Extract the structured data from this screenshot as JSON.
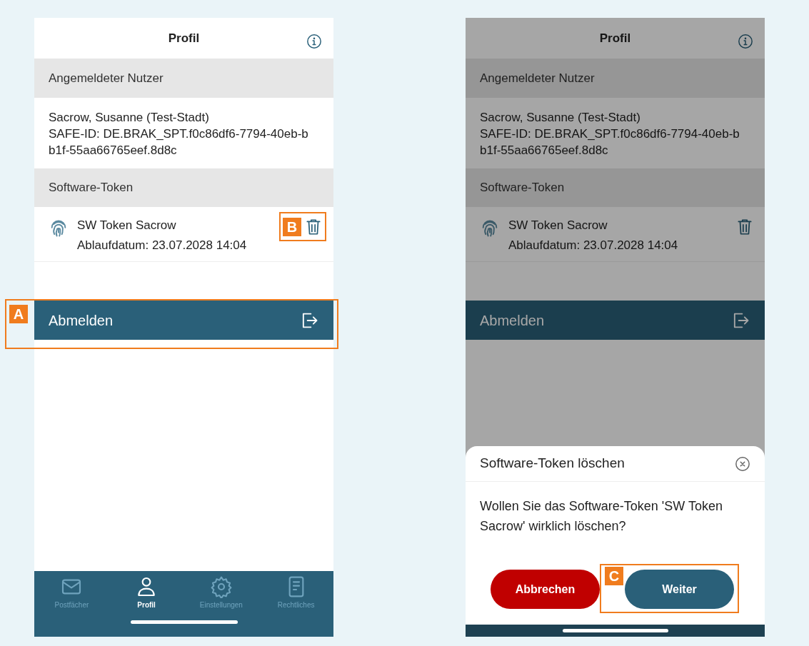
{
  "screens": [
    {
      "dimmed": false,
      "title": "Profil",
      "user_section": "Angemeldeter Nutzer",
      "user_name": "Sacrow, Susanne (Test-Stadt)",
      "safe_id": "SAFE-ID: DE.BRAK_SPT.f0c86df6-7794-40eb-b b1f-55aa66765eef.8d8c",
      "token_section": "Software-Token",
      "token": {
        "name": "SW Token Sacrow",
        "expiry": "Ablaufdatum: 23.07.2028 14:04",
        "callout": "B"
      },
      "logout": {
        "label": "Abmelden",
        "callout": "A"
      },
      "tab_bar": [
        {
          "label": "Postfächer",
          "selected": false
        },
        {
          "label": "Profil",
          "selected": true
        },
        {
          "label": "Einstellungen",
          "selected": false
        },
        {
          "label": "Rechtliches",
          "selected": false
        }
      ]
    },
    {
      "dimmed": true,
      "title": "Profil",
      "user_section": "Angemeldeter Nutzer",
      "user_name": "Sacrow, Susanne (Test-Stadt)",
      "safe_id": "SAFE-ID: DE.BRAK_SPT.f0c86df6-7794-40eb-b b1f-55aa66765eef.8d8c",
      "token_section": "Software-Token",
      "token": {
        "name": "SW Token Sacrow",
        "expiry": "Ablaufdatum: 23.07.2028 14:04"
      },
      "logout": {
        "label": "Abmelden"
      },
      "dialog": {
        "title": "Software-Token löschen",
        "message": "Wollen Sie das Software-Token 'SW Token Sacrow' wirklich löschen?",
        "cancel": "Abbrechen",
        "confirm": {
          "label": "Weiter",
          "callout": "C"
        }
      }
    }
  ]
}
